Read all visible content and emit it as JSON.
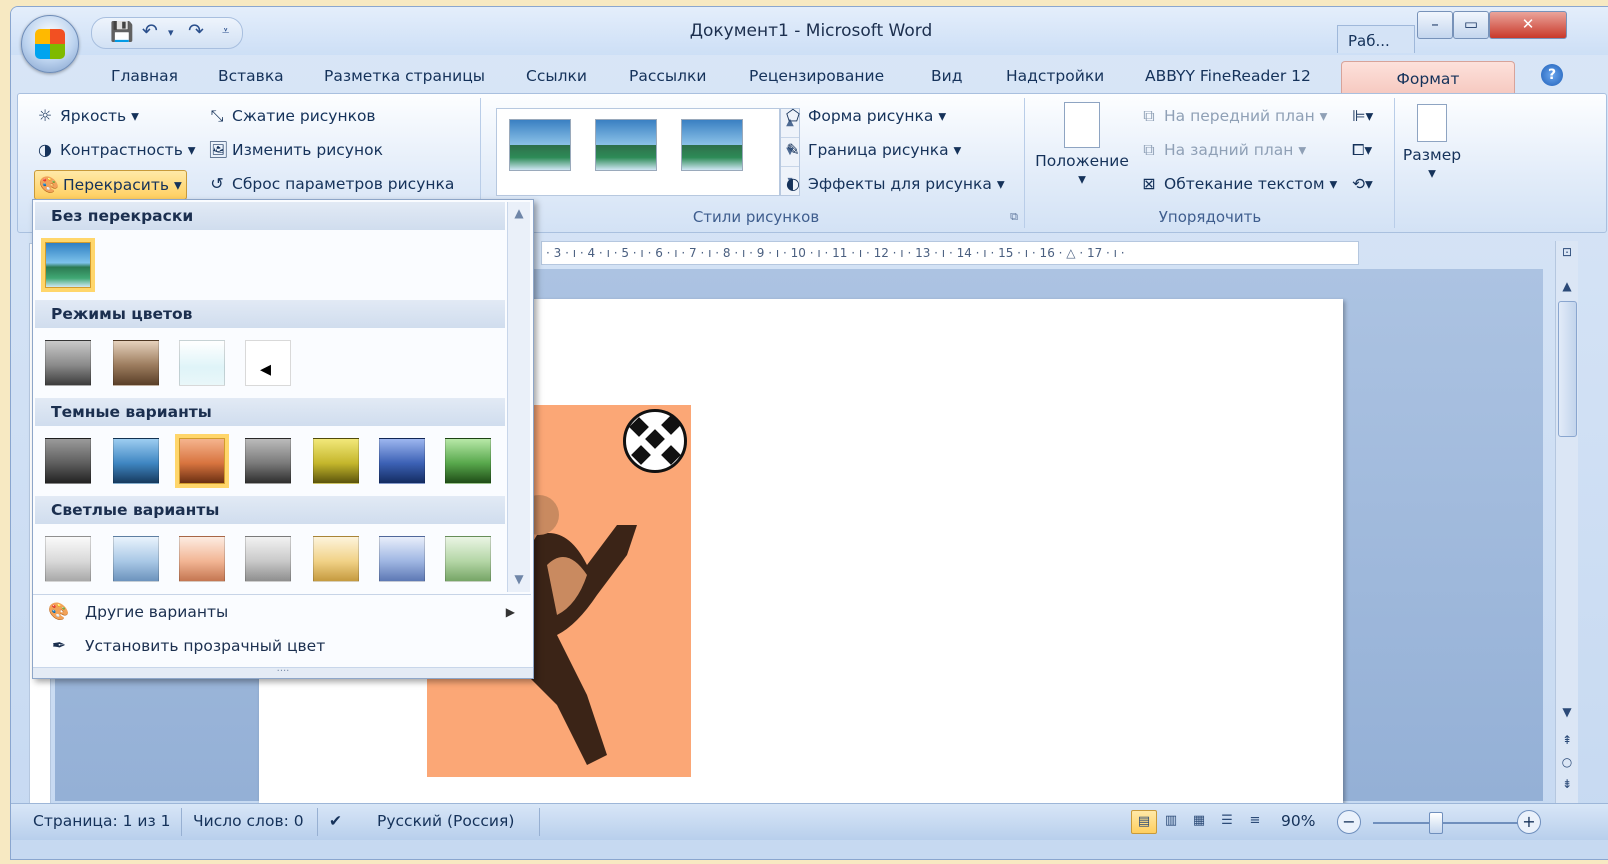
{
  "window": {
    "title": "Документ1 - Microsoft Word",
    "taskbar_label": "Раб..."
  },
  "tabs": [
    "Главная",
    "Вставка",
    "Разметка страницы",
    "Ссылки",
    "Рассылки",
    "Рецензирование",
    "Вид",
    "Надстройки",
    "ABBYY FineReader 12",
    "Формат"
  ],
  "ribbon": {
    "adjust": {
      "brightness": "Яркость",
      "contrast": "Контрастность",
      "recolor": "Перекрасить",
      "compress": "Сжатие рисунков",
      "change": "Изменить рисунок",
      "reset": "Сброс параметров рисунка"
    },
    "styles": {
      "shape": "Форма рисунка",
      "border": "Граница рисунка",
      "effects": "Эффекты для рисунка",
      "label": "Стили рисунков"
    },
    "arrange": {
      "position": "Положение",
      "front": "На передний план",
      "back": "На задний план",
      "wrap": "Обтекание текстом",
      "label": "Упорядочить"
    },
    "size": {
      "label": "Размер"
    }
  },
  "ruler": "· 3 · ı · 4 · ı · 5 · ı · 6 · ı · 7 · ı · 8 · ı · 9 · ı · 10 · ı · 11 · ı · 12 · ı · 13 · ı · 14 · ı · 15 · ı · 16 · △ · 17 · ı ·",
  "dropdown": {
    "no_recolor": "Без перекраски",
    "color_modes": "Режимы цветов",
    "dark_variations": "Темные варианты",
    "light_variations": "Светлые варианты",
    "more_variations": "Другие варианты",
    "set_transparent": "Установить прозрачный цвет",
    "swatch_colors": {
      "color_modes": [
        "#8a8a8a",
        "#9c7c5e",
        "#dff4f8",
        "#ffffff"
      ],
      "dark": [
        "#5e5e5e",
        "#3f86c2",
        "#d8743f",
        "#7a7a7a",
        "#c5b72c",
        "#3c61b5",
        "#58a84c"
      ],
      "light": [
        "#d9d9d9",
        "#a9c8e6",
        "#f2b594",
        "#c9c9c9",
        "#f1d287",
        "#9fb6e2",
        "#b4d6a6"
      ]
    }
  },
  "status": {
    "page": "Страница: 1 из 1",
    "words": "Число слов: 0",
    "language": "Русский (Россия)",
    "zoom": "90%"
  }
}
